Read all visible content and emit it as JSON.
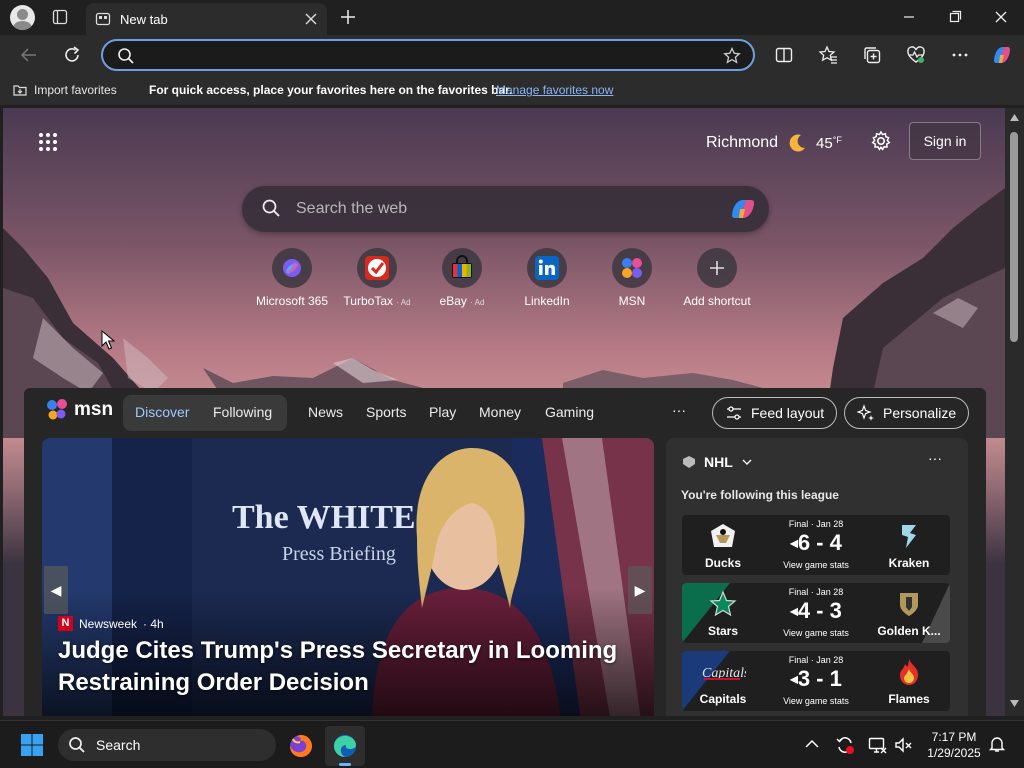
{
  "browser": {
    "tab_title": "New tab",
    "address_value": "",
    "favorites_bar": {
      "import_label": "Import favorites",
      "message": "For quick access, place your favorites here on the favorites bar.",
      "manage_link": "Manage favorites now"
    }
  },
  "newtab": {
    "weather": {
      "city": "Richmond",
      "temp": "45",
      "unit": "°F",
      "icon": "moon-icon"
    },
    "signin_label": "Sign in",
    "search_placeholder": "Search the web",
    "shortcuts": [
      {
        "label": "Microsoft 365",
        "ad": ""
      },
      {
        "label": "TurboTax",
        "ad": "· Ad"
      },
      {
        "label": "eBay",
        "ad": "· Ad"
      },
      {
        "label": "LinkedIn",
        "ad": ""
      },
      {
        "label": "MSN",
        "ad": ""
      },
      {
        "label": "Add shortcut",
        "ad": ""
      }
    ]
  },
  "msn": {
    "logo_text": "msn",
    "tabs": {
      "discover": "Discover",
      "following": "Following"
    },
    "nav": [
      "News",
      "Sports",
      "Play",
      "Money",
      "Gaming"
    ],
    "more": "···",
    "feed_layout": "Feed layout",
    "personalize": "Personalize",
    "hero": {
      "source": "Newsweek",
      "age": "· 4h",
      "headline": "Judge Cites Trump's Press Secretary in Looming Restraining Order Decision"
    },
    "nhl": {
      "title": "NHL",
      "subtitle": "You're following this league",
      "games": [
        {
          "home": "Ducks",
          "away": "Kraken",
          "status": "Final · Jan 28",
          "score": "6 - 4",
          "stats": "View game stats"
        },
        {
          "home": "Stars",
          "away": "Golden K...",
          "status": "Final · Jan 28",
          "score": "4 - 3",
          "stats": "View game stats"
        },
        {
          "home": "Capitals",
          "away": "Flames",
          "status": "Final · Jan 28",
          "score": "3 - 1",
          "stats": "View game stats"
        }
      ]
    }
  },
  "taskbar": {
    "search_label": "Search",
    "time": "7:17 PM",
    "date": "1/29/2025"
  },
  "colors": {
    "accent": "#6ea0e0",
    "link": "#8ab4f8",
    "taskbar": "#1c1c1c"
  }
}
